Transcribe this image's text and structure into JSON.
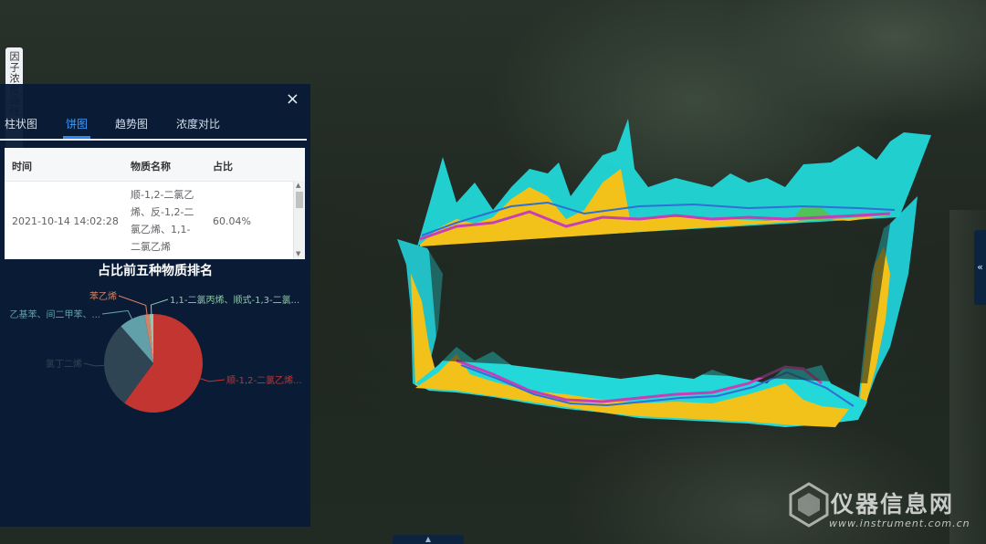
{
  "side_tab": {
    "label": "因子浓度曲线"
  },
  "panel": {
    "close_icon": "×",
    "tabs": [
      {
        "label": "柱状图",
        "active": false
      },
      {
        "label": "饼图",
        "active": true
      },
      {
        "label": "趋势图",
        "active": false
      },
      {
        "label": "浓度对比",
        "active": false
      }
    ],
    "table": {
      "headers": [
        "时间",
        "物质名称",
        "占比"
      ],
      "rows": [
        {
          "time": "2021-10-14 14:02:28",
          "name_lines": [
            "顺-1,2-二氯乙",
            "烯、反-1,2-二",
            "氯乙烯、1,1-",
            "二氯乙烯"
          ],
          "ratio": "60.04%"
        }
      ]
    },
    "chart_title": "占比前五种物质排名"
  },
  "chart_data": {
    "type": "pie",
    "title": "占比前五种物质排名",
    "slices": [
      {
        "label": "顺-1,2-二氯乙烯...",
        "value": 60.04,
        "color": "#c23531"
      },
      {
        "label": "氯丁二烯",
        "value": 28.5,
        "color": "#2f4554"
      },
      {
        "label": "乙基苯、间二甲苯、...",
        "value": 8.6,
        "color": "#61a0a8"
      },
      {
        "label": "苯乙烯",
        "value": 1.6,
        "color": "#d48265"
      },
      {
        "label": "1,1-二氯丙烯、顺式-1,3-二氯...",
        "value": 1.26,
        "color": "#91c7ae"
      }
    ]
  },
  "collapse_icon": "«",
  "bottom_tab_icon": "▲",
  "watermark": {
    "title": "仪器信息网",
    "url": "www.instrument.com.cn"
  }
}
